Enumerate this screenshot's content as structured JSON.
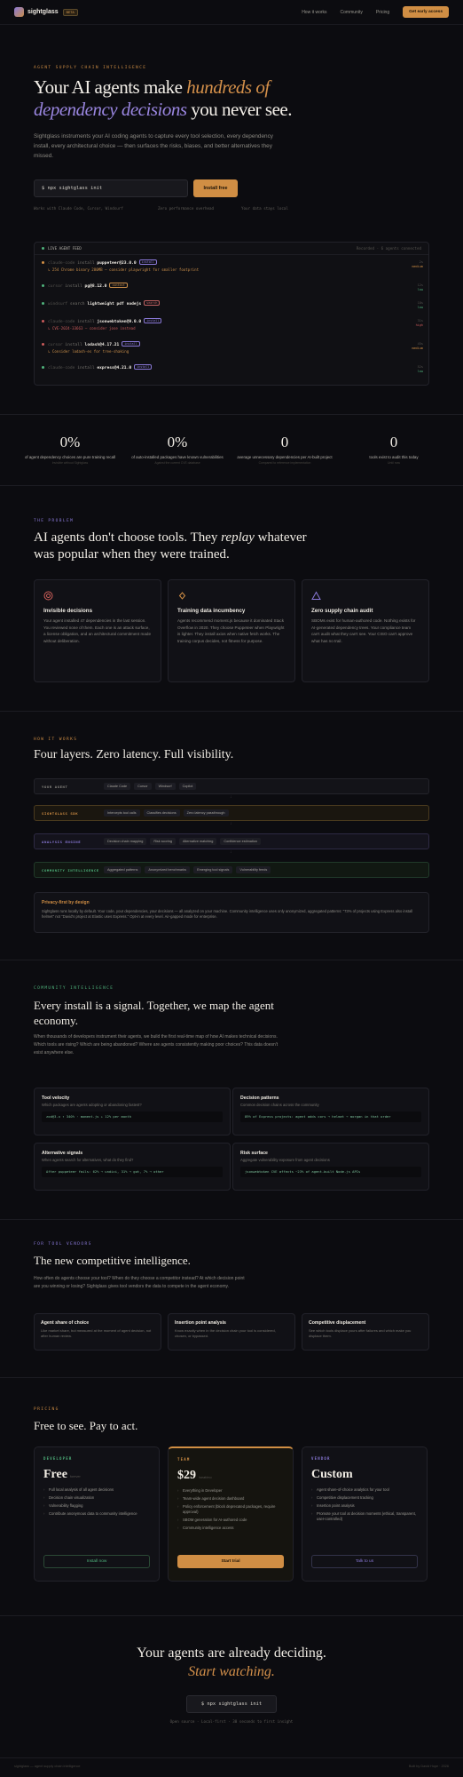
{
  "nav": {
    "brand": "sightglass",
    "badge": "BETA",
    "links": [
      "How it works",
      "Community",
      "Pricing"
    ],
    "cta": "Get early access"
  },
  "hero": {
    "eyebrow": "AGENT SUPPLY CHAIN INTELLIGENCE",
    "title_1": "Your AI agents make ",
    "title_accent": "hundreds of",
    "title_lav": "dependency decisions",
    "title_2": " you never see.",
    "lead": "Sightglass instruments your AI coding agents to capture every tool selection, every dependency install, every architectural choice — then surfaces the risks, biases, and better alternatives they missed.",
    "command": "$ npx sightglass init",
    "button": "Install free",
    "notes": [
      "Works with Claude Code, Cursor, Windsurf",
      "Zero performance overhead",
      "Your data stays local"
    ]
  },
  "feed": {
    "title": "LIVE AGENT FEED",
    "status": "Recorded · 6 agents connected",
    "rows": [
      {
        "agent": "claude-code",
        "verb": "install",
        "pkg": "puppeteer@23.0.0",
        "tag": "install",
        "tag_color": "#8a79d8",
        "dot": "#d08e44",
        "sub": "↳ 254 Chrome binary 280MB — consider playwright for smaller footprint",
        "sub_color": "#c98e4a",
        "t1": "2s",
        "t2": "medium"
      },
      {
        "agent": "cursor",
        "verb": "install",
        "pkg": "pg@8.12.0",
        "tag": "context",
        "tag_color": "#c98e4a",
        "dot": "#4fb37c",
        "sub": "",
        "sub_color": "",
        "t1": "12s",
        "t2": "low"
      },
      {
        "agent": "windsurf",
        "verb": "search",
        "pkg": "lightweight pdf nodejs",
        "tag": "search",
        "tag_color": "#c26262",
        "dot": "#4fb37c",
        "sub": "",
        "sub_color": "",
        "t1": "18s",
        "t2": "low"
      },
      {
        "agent": "claude-code",
        "verb": "install",
        "pkg": "jsonwebtoken@9.0.0",
        "tag": "install",
        "tag_color": "#8a79d8",
        "dot": "#c95a5a",
        "sub": "↳ CVE-2024-33663 — consider jose instead",
        "sub_color": "#c95a5a",
        "t1": "31s",
        "t2": "high"
      },
      {
        "agent": "cursor",
        "verb": "install",
        "pkg": "lodash@4.17.21",
        "tag": "install",
        "tag_color": "#8a79d8",
        "dot": "#c95a5a",
        "sub": "↳ Consider lodash-es for tree-shaking",
        "sub_color": "#c98e4a",
        "t1": "45s",
        "t2": "medium"
      },
      {
        "agent": "claude-code",
        "verb": "install",
        "pkg": "express@4.21.0",
        "tag": "install",
        "tag_color": "#8a79d8",
        "dot": "#4fb37c",
        "sub": "",
        "sub_color": "",
        "t1": "52s",
        "t2": "low"
      }
    ]
  },
  "stats": [
    {
      "n": "0%",
      "l": "of agent dependency choices are pure training recall",
      "s": "Invisible without Sightglass"
    },
    {
      "n": "0%",
      "l": "of auto-installed packages have known vulnerabilities",
      "s": "Against the current CVE database"
    },
    {
      "n": "0",
      "l": "average unnecessary dependencies per AI-built project",
      "s": "Compared to reference implementation"
    },
    {
      "n": "0",
      "l": "tools exist to audit this today",
      "s": "Until now"
    }
  ],
  "problem": {
    "eyebrow": "THE PROBLEM",
    "title_1": "AI agents don't choose tools. They ",
    "title_em": "replay",
    "title_2": " whatever",
    "title_3": "was popular when they were trained.",
    "cards": [
      {
        "title": "Invisible decisions",
        "body": "Your agent installed 47 dependencies in the last session. You reviewed none of them. Each one is an attack surface, a license obligation, and an architectural commitment made without deliberation.",
        "icon_color": "#d0605a"
      },
      {
        "title": "Training data incumbency",
        "body": "Agents recommend moment.js because it dominated Stack Overflow in 2020. They choose Puppeteer when Playwright is lighter. They install axios when native fetch works. The training corpus decides, not fitness for purpose.",
        "icon_color": "#d08e44"
      },
      {
        "title": "Zero supply chain audit",
        "body": "SBOMs exist for human-authored code. Nothing exists for AI-generated dependency trees. Your compliance team can't audit what they can't see. Your CISO can't approve what has no trail.",
        "icon_color": "#8a79d8"
      }
    ]
  },
  "how": {
    "eyebrow": "HOW IT WORKS",
    "title": "Four layers. Zero latency. Full visibility.",
    "layers": [
      {
        "name": "YOUR AGENT",
        "color": "#8a8882",
        "items": [
          "Claude Code",
          "Cursor",
          "Windsurf",
          "Copilot"
        ]
      },
      {
        "name": "SIGHTGLASS SDK",
        "color": "#d08e44",
        "items": [
          "Intercepts tool calls",
          "Classifies decisions",
          "Zero latency passthrough"
        ]
      },
      {
        "name": "ANALYSIS ENGINE",
        "color": "#8a79d8",
        "items": [
          "Decision chain mapping",
          "Risk scoring",
          "Alternative matching",
          "Confidence estimation"
        ]
      },
      {
        "name": "COMMUNITY INTELLIGENCE",
        "color": "#4fb37c",
        "items": [
          "Aggregated patterns",
          "Anonymized benchmarks",
          "Emerging tool signals",
          "Vulnerability feeds"
        ]
      }
    ],
    "privacy_title": "Privacy-first by design",
    "privacy_body": "Sightglass runs locally by default. Your code, your dependencies, your decisions — all analyzed on your machine. Community intelligence uses only anonymized, aggregated patterns: \"73% of projects using Express also install helmet\" not \"David's project at Elastic uses Express.\" Opt-in at every level. Air-gapped mode for enterprise."
  },
  "community": {
    "eyebrow": "COMMUNITY INTELLIGENCE",
    "title_1": "Every install is a signal. Together, we map the agent",
    "title_2": "economy.",
    "lead": "When thousands of developers instrument their agents, we build the first real-time map of how AI makes technical decisions. Which tools are rising? Which are being abandoned? Where are agents consistently making poor choices? This data doesn't exist anywhere else.",
    "cards": [
      {
        "title": "Tool velocity",
        "desc": "Which packages are agents adopting or abandoning fastest?",
        "code": "zod@3.x ↑ 340% · moment.js ↓ 12% per month"
      },
      {
        "title": "Decision patterns",
        "desc": "Common decision chains across the community",
        "code": "89% of Express projects: agent adds cors → helmet → morgan in that order"
      },
      {
        "title": "Alternative signals",
        "desc": "When agents search for alternatives, what do they find?",
        "code": "After puppeteer fails: 62% → undici, 31% → got, 7% → other"
      },
      {
        "title": "Risk surface",
        "desc": "Aggregate vulnerability exposure from agent decisions",
        "code": "jsonwebtoken CVE affects ~23% of agent-built Node.js APIs"
      }
    ]
  },
  "vendors": {
    "eyebrow": "FOR TOOL VENDORS",
    "title": "The new competitive intelligence.",
    "lead": "How often do agents choose your tool? When do they choose a competitor instead? At which decision point are you winning or losing? Sightglass gives tool vendors the data to compete in the agent economy.",
    "cards": [
      {
        "title": "Agent share of choice",
        "body": "Like market share, but measured at the moment of agent decision, not after human review."
      },
      {
        "title": "Insertion point analysis",
        "body": "Know exactly when in the decision chain your tool is considered, chosen, or bypassed."
      },
      {
        "title": "Competitive displacement",
        "body": "See which tools displace yours after failures and which make you displace them."
      }
    ]
  },
  "pricing": {
    "eyebrow": "PRICING",
    "title": "Free to see. Pay to act.",
    "plans": [
      {
        "name": "DEVELOPER",
        "color": "#4fb37c",
        "price": "Free",
        "unit": "forever",
        "items": [
          "Full local analysis of all agent decisions",
          "Decision chain visualization",
          "Vulnerability flagging",
          "Contribute anonymous data to community intelligence"
        ],
        "cta": "Install now"
      },
      {
        "name": "TEAM",
        "color": "#d08e44",
        "price": "$29",
        "unit": "/seat/mo",
        "items": [
          "Everything in Developer",
          "Team-wide agent decision dashboard",
          "Policy enforcement (block deprecated packages, require approval)",
          "SBOM generation for AI-authored code",
          "Community intelligence access"
        ],
        "cta": "Start trial"
      },
      {
        "name": "VENDOR",
        "color": "#8a79d8",
        "price": "Custom",
        "unit": "",
        "items": [
          "Agent share-of-choice analytics for your tool",
          "Competitive displacement tracking",
          "Insertion point analysis",
          "Promote your tool at decision moments (ethical, transparent, user-controlled)"
        ],
        "cta": "Talk to us"
      }
    ]
  },
  "final": {
    "title_1": "Your agents are already deciding.",
    "title_2": "Start watching.",
    "command": "$ npx sightglass init",
    "note": "Open source · Local-first · 30 seconds to first insight"
  },
  "footer": {
    "left": "sightglass — agent supply chain intelligence",
    "right": "Built by David Hope · 2026"
  }
}
